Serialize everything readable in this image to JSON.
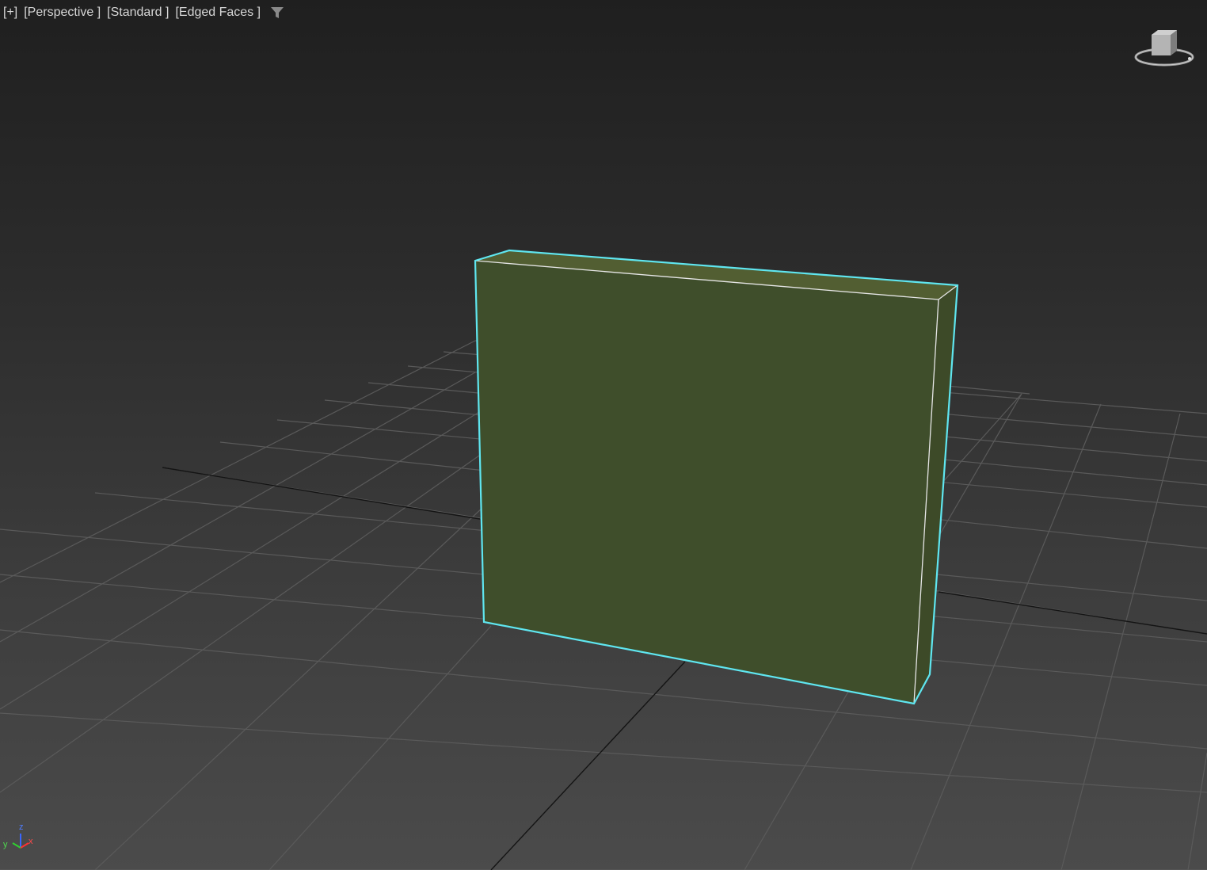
{
  "viewport": {
    "menu": {
      "plus": "[+]",
      "view": "[Perspective ]",
      "shading": "[Standard ]",
      "display": "[Edged Faces ]",
      "filter_icon": "funnel-icon"
    },
    "viewcube_icon": "viewcube-icon",
    "axis_tripod": {
      "z": "z",
      "y": "y",
      "x": "x"
    },
    "colors": {
      "background_top": "#1f1f1f",
      "background_bottom": "#4b4b4b",
      "grid": "#5a5a5a",
      "object_fill": "#3f4e2b",
      "object_top_fill": "#525e32",
      "selection_outline": "#5fe6f0",
      "object_edges": "#e6e6e6"
    }
  }
}
